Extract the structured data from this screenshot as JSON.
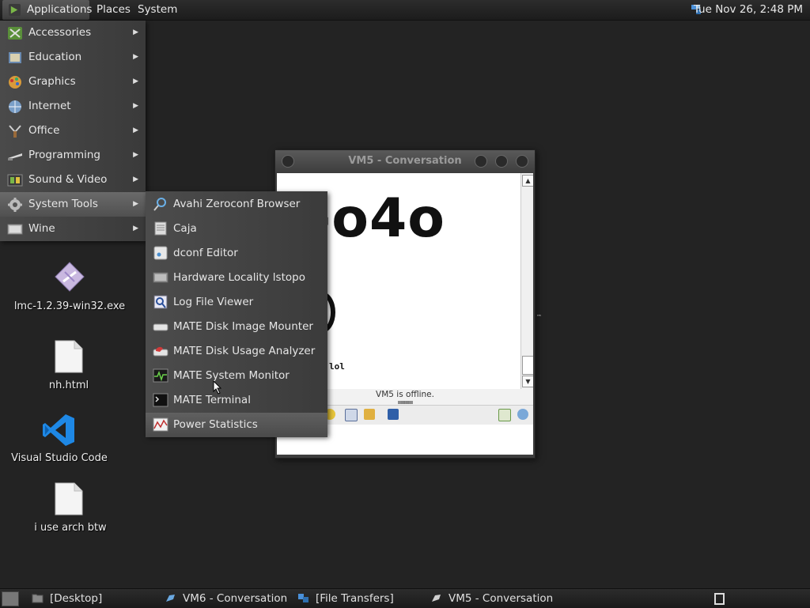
{
  "top_panel": {
    "applications": "Applications",
    "places": "Places",
    "system": "System",
    "clock": "Tue Nov 26,  2:48 PM"
  },
  "apps_menu": {
    "items": [
      {
        "label": "Accessories",
        "icon": "accessories-icon"
      },
      {
        "label": "Education",
        "icon": "education-icon"
      },
      {
        "label": "Graphics",
        "icon": "graphics-icon"
      },
      {
        "label": "Internet",
        "icon": "internet-icon"
      },
      {
        "label": "Office",
        "icon": "office-icon"
      },
      {
        "label": "Programming",
        "icon": "programming-icon"
      },
      {
        "label": "Sound & Video",
        "icon": "sound-video-icon"
      },
      {
        "label": "System Tools",
        "icon": "gear-icon",
        "active": true
      },
      {
        "label": "Wine",
        "icon": "wine-icon"
      }
    ]
  },
  "system_tools_menu": {
    "items": [
      {
        "label": "Avahi Zeroconf Browser",
        "icon": "avahi-icon"
      },
      {
        "label": "Caja",
        "icon": "file-manager-icon"
      },
      {
        "label": "dconf Editor",
        "icon": "dconf-icon"
      },
      {
        "label": "Hardware Locality lstopo",
        "icon": "hardware-icon"
      },
      {
        "label": "Log File Viewer",
        "icon": "log-viewer-icon"
      },
      {
        "label": "MATE Disk Image Mounter",
        "icon": "disk-mounter-icon"
      },
      {
        "label": "MATE Disk Usage Analyzer",
        "icon": "disk-usage-icon"
      },
      {
        "label": "MATE System Monitor",
        "icon": "system-monitor-icon"
      },
      {
        "label": "MATE Terminal",
        "icon": "terminal-icon"
      },
      {
        "label": "Power Statistics",
        "icon": "power-stats-icon",
        "active": true
      }
    ]
  },
  "desktop_icons": [
    {
      "label": "lmc-1.2.39-win32.exe",
      "icon": "exe-icon"
    },
    {
      "label": "nh.html",
      "icon": "document-icon"
    },
    {
      "label": "Visual Studio Code",
      "icon": "vscode-icon"
    },
    {
      "label": "i use arch btw",
      "icon": "document-icon"
    }
  ],
  "conversation_window": {
    "title": "VM5 - Conversation",
    "big_text": "-o4o",
    "message": "lol",
    "status": "VM5 is offline.",
    "status_bar": "ıııııııııııııııııııı"
  },
  "taskbar": {
    "items": [
      {
        "label": "[Desktop]",
        "icon": "folder-icon"
      },
      {
        "label": "VM6 - Conversation",
        "icon": "chat-icon"
      },
      {
        "label": "[File Transfers]",
        "icon": "transfer-icon"
      },
      {
        "label": "VM5 - Conversation",
        "icon": "chat-icon"
      }
    ]
  },
  "colors": {
    "panel": "#222222",
    "menu_bg": "#454545",
    "menu_active": "#5a5a5a",
    "vscode_blue": "#1e88e5"
  }
}
